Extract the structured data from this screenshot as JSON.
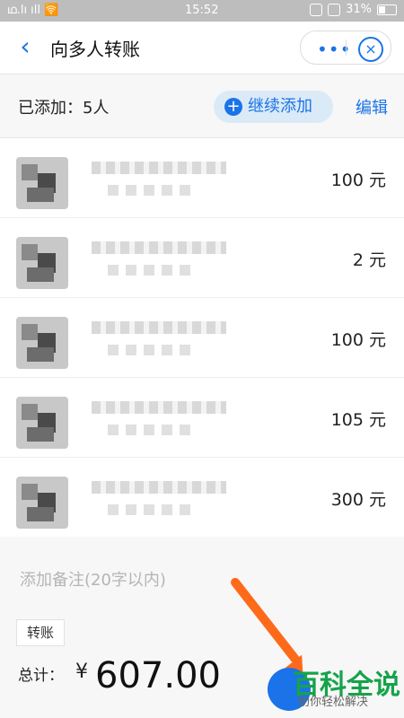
{
  "status": {
    "left": "ഥ.lı ıll 🛜",
    "time": "15:52",
    "right": "31%"
  },
  "header": {
    "title": "向多人转账"
  },
  "added": {
    "label": "已添加：5人",
    "continue_label": "继续添加",
    "edit_label": "编辑"
  },
  "items": [
    {
      "amount": "100 元"
    },
    {
      "amount": "2 元"
    },
    {
      "amount": "100 元"
    },
    {
      "amount": "105 元"
    },
    {
      "amount": "300 元"
    }
  ],
  "note": {
    "placeholder": "添加备注(20字以内)",
    "tag": "转账"
  },
  "total": {
    "label": "总计：",
    "currency": "¥",
    "value": "607.00"
  },
  "watermark": {
    "title": "百科全说",
    "subtitle": "助你轻松解决"
  }
}
